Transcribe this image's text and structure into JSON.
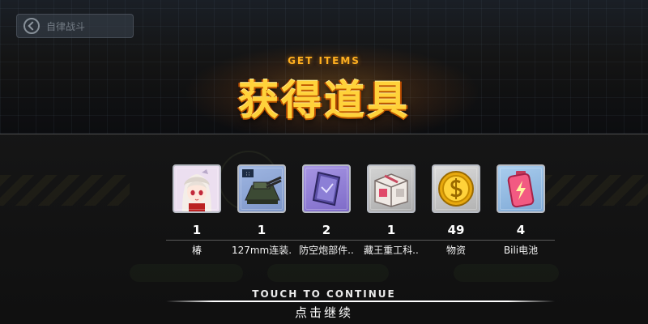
{
  "header": {
    "back_label": "自律战斗",
    "title_en": "GET ITEMS",
    "title_cn": "获得道具"
  },
  "items": [
    {
      "count": "1",
      "name": "椿",
      "icon": "shipgirl-portrait-icon",
      "frame_color": "#c9a0d8"
    },
    {
      "count": "1",
      "name": "127mm连装.",
      "icon": "naval-gun-turret-icon",
      "frame_color": "#8aa7d8"
    },
    {
      "count": "2",
      "name": "防空炮部件..",
      "icon": "equipment-part-icon",
      "frame_color": "#9d8fe0"
    },
    {
      "count": "1",
      "name": "藏王重工科..",
      "icon": "supply-crate-icon",
      "frame_color": "#b9b9b9"
    },
    {
      "count": "49",
      "name": "物资",
      "icon": "gold-coin-icon",
      "frame_color": "#c8c8c8"
    },
    {
      "count": "4",
      "name": "Bili电池",
      "icon": "battery-icon",
      "frame_color": "#8fb6e0"
    }
  ],
  "footer": {
    "continue_en": "TOUCH TO CONTINUE",
    "continue_cn": "点击继续"
  }
}
